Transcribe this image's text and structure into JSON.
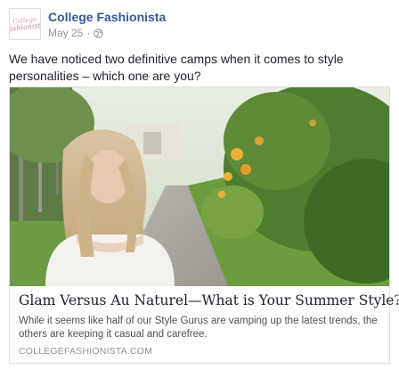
{
  "post": {
    "page_name": "College Fashionista",
    "date": "May 25",
    "separator": "·",
    "avatar_logo_line1": "College",
    "avatar_logo_line2": "fashionista",
    "text": "We have noticed two definitive camps when it comes to style personalities – which one are you?",
    "privacy_icon": "globe-icon"
  },
  "link": {
    "title": "Glam Versus Au Naturel—What is Your Summer Style?",
    "description": "While it seems like half of our Style Gurus are vamping up the latest trends, the others are keeping it casual and carefree.",
    "domain": "COLLEGEFASHIONISTA.COM"
  }
}
